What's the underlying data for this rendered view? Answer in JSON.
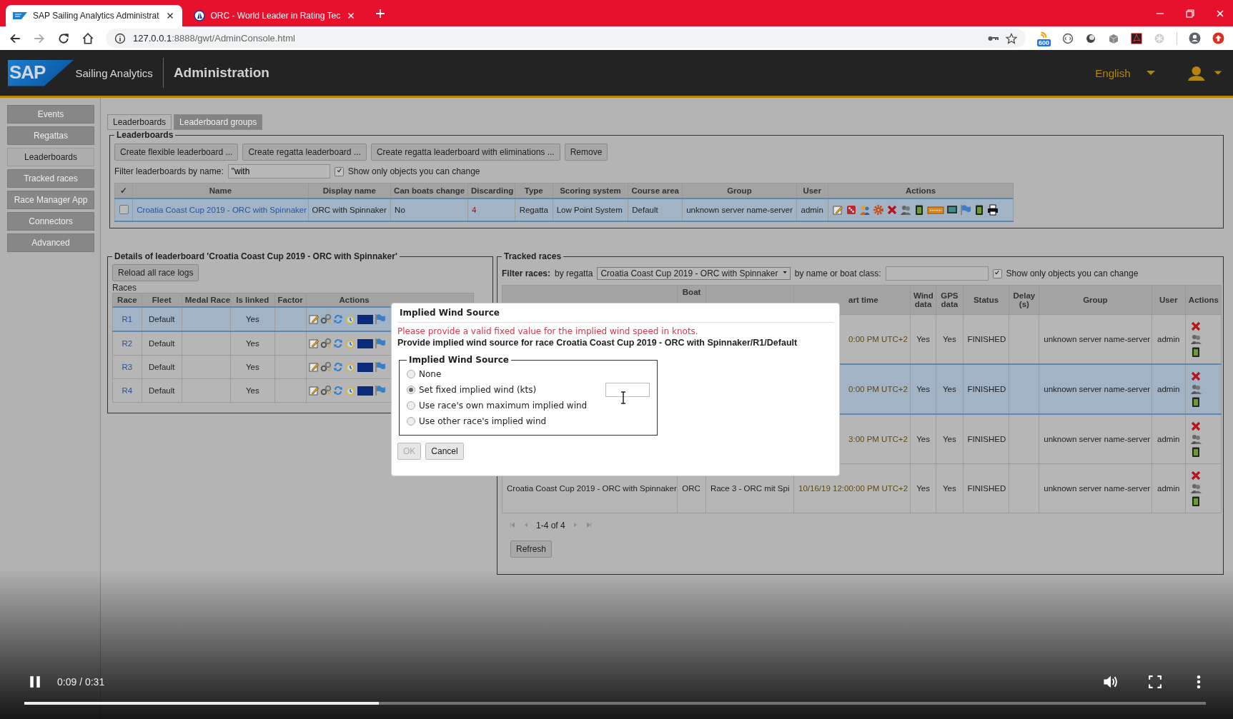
{
  "browser": {
    "tabs": [
      {
        "title": "SAP Sailing Analytics Administrat",
        "selected": true
      },
      {
        "title": "ORC - World Leader in Rating Tec",
        "selected": false
      }
    ],
    "url_host": "127.0.0.1",
    "url_rest": ":8888/gwt/AdminConsole.html",
    "extension_badge": "600"
  },
  "app": {
    "logo": "SAP",
    "product": "Sailing Analytics",
    "title": "Administration",
    "language": "English"
  },
  "sidebar": {
    "items": [
      {
        "label": "Events",
        "selected": false
      },
      {
        "label": "Regattas",
        "selected": false
      },
      {
        "label": "Leaderboards",
        "selected": true
      },
      {
        "label": "Tracked races",
        "selected": false
      },
      {
        "label": "Race Manager App",
        "selected": false
      },
      {
        "label": "Connectors",
        "selected": false
      },
      {
        "label": "Advanced",
        "selected": false
      }
    ]
  },
  "tabs": [
    {
      "label": "Leaderboards",
      "selected": true
    },
    {
      "label": "Leaderboard groups",
      "selected": false
    }
  ],
  "leaderboards": {
    "legend": "Leaderboards",
    "buttons": [
      "Create flexible leaderboard ...",
      "Create regatta leaderboard ...",
      "Create regatta leaderboard with eliminations ...",
      "Remove"
    ],
    "filter_label": "Filter leaderboards by name:",
    "filter_value": "\"with",
    "show_only_mine": {
      "label": "Show only objects you can change",
      "checked": true
    },
    "columns": [
      "✓",
      "Name",
      "Display name",
      "Can boats change",
      "Discarding",
      "Type",
      "Scoring system",
      "Course area",
      "Group",
      "User",
      "Actions"
    ],
    "rows": [
      {
        "checked": false,
        "highlighted": true,
        "name": "Croatia Coast Cup 2019 - ORC with Spinnaker",
        "display_name": "ORC with Spinnaker",
        "can_boats_change": "No",
        "discarding": "4",
        "type": "Regatta",
        "scoring_system": "Low Point System",
        "course_area": "Default",
        "group": "unknown server name-server",
        "user": "admin"
      }
    ]
  },
  "details": {
    "legend": "Details of leaderboard 'Croatia Coast Cup 2019 - ORC with Spinnaker'",
    "reload_button": "Reload all race logs",
    "caption": "Races",
    "columns": [
      "Race",
      "Fleet",
      "Medal Race",
      "Is linked",
      "Factor",
      "Actions"
    ],
    "rows": [
      {
        "race": "R1",
        "fleet": "Default",
        "is_linked": "Yes",
        "highlighted": true
      },
      {
        "race": "R2",
        "fleet": "Default",
        "is_linked": "Yes",
        "highlighted": false
      },
      {
        "race": "R3",
        "fleet": "Default",
        "is_linked": "Yes",
        "highlighted": false
      },
      {
        "race": "R4",
        "fleet": "Default",
        "is_linked": "Yes",
        "highlighted": false
      }
    ]
  },
  "tracked": {
    "legend": "Tracked races",
    "filter_label": "Filter races:",
    "by_regatta_label": "by regatta",
    "regatta_value": "Croatia Coast Cup 2019 - ORC with Spinnaker",
    "by_name_label": "by name or boat class:",
    "show_only_mine": {
      "label": "Show only objects you can change",
      "checked": true
    },
    "columns": [
      null,
      "Boat",
      null,
      "art time",
      "Wind data",
      "GPS data",
      "Status",
      "Delay (s)",
      "Group",
      "User",
      "Actions"
    ],
    "rows": [
      {
        "start_time": "0:00 PM UTC+2",
        "wind_data": "Yes",
        "gps_data": "Yes",
        "status": "FINISHED",
        "group": "unknown server name-server",
        "user": "admin",
        "highlighted": false
      },
      {
        "start_time": "0:00 PM UTC+2",
        "wind_data": "Yes",
        "gps_data": "Yes",
        "status": "FINISHED",
        "group": "unknown server name-server",
        "user": "admin",
        "highlighted": true
      },
      {
        "start_time": "3:00 PM UTC+2",
        "wind_data": "Yes",
        "gps_data": "Yes",
        "status": "FINISHED",
        "group": "unknown server name-server",
        "user": "admin",
        "highlighted": false
      },
      {
        "regatta": "Croatia Coast Cup 2019 - ORC with Spinnaker",
        "boat_class": "ORC",
        "race": "Race 3 - ORC mit Spi",
        "start_time": "10/16/19 12:00:00 PM UTC+2",
        "wind_data": "Yes",
        "gps_data": "Yes",
        "status": "FINISHED",
        "group": "unknown server name-server",
        "user": "admin",
        "highlighted": false
      }
    ],
    "pager": "1-4 of 4",
    "refresh_button": "Refresh"
  },
  "dialog": {
    "title": "Implied Wind Source",
    "error": "Please provide a valid fixed value for the implied wind speed in knots.",
    "prompt": "Provide implied wind source for race Croatia Coast Cup 2019 - ORC with Spinnaker/R1/Default",
    "group_legend": "Implied Wind Source",
    "options": [
      {
        "label": "None",
        "selected": false
      },
      {
        "label": "Set fixed implied wind (kts)",
        "selected": true
      },
      {
        "label": "Use race's own maximum implied wind",
        "selected": false
      },
      {
        "label": "Use other race's implied wind",
        "selected": false
      }
    ],
    "buttons": [
      {
        "label": "OK",
        "disabled": true
      },
      {
        "label": "Cancel",
        "disabled": false
      }
    ]
  },
  "video": {
    "time": "0:09 / 0:31",
    "level": 0.3
  }
}
